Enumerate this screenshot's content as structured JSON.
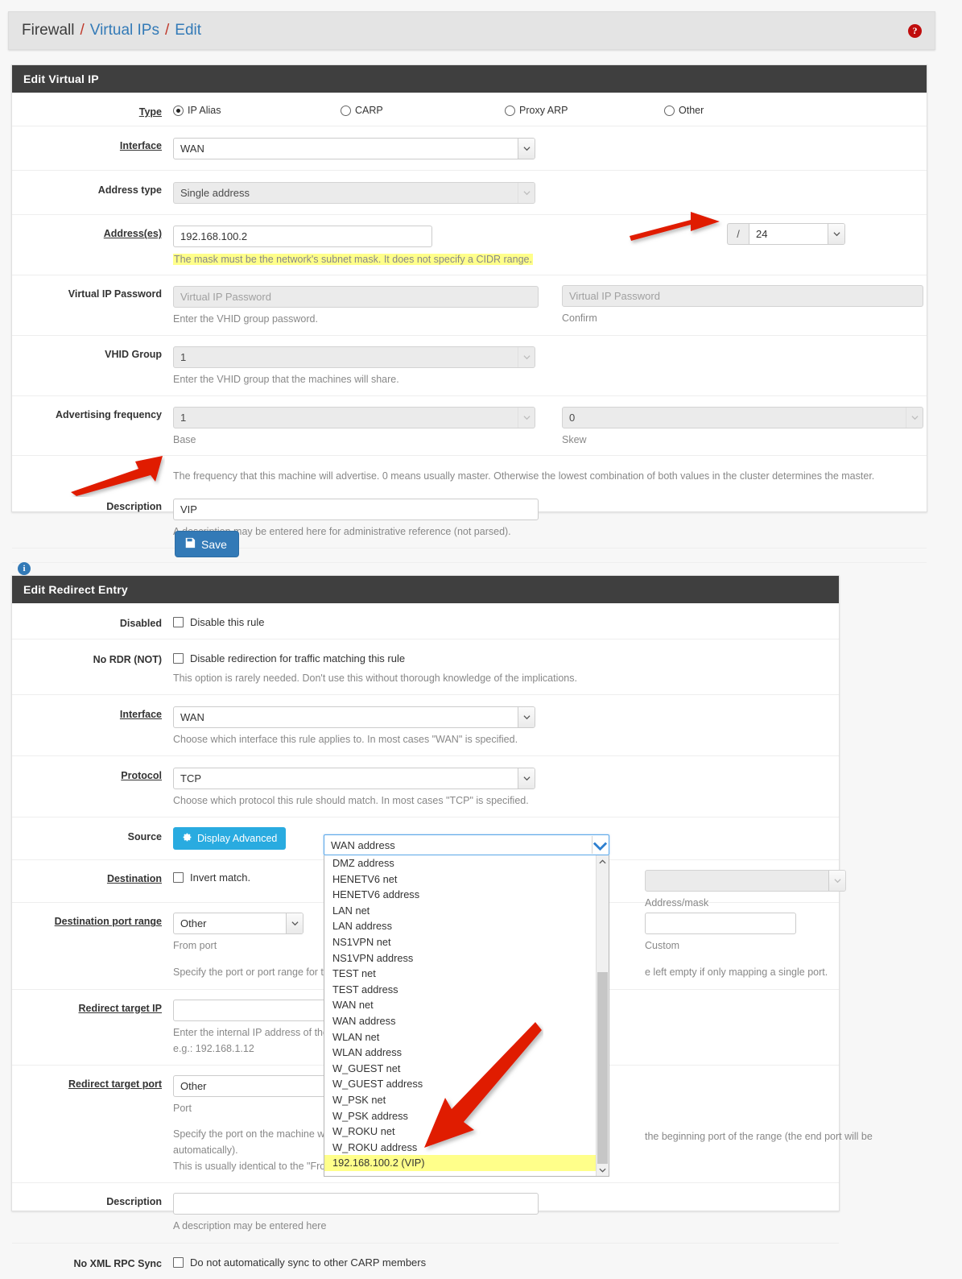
{
  "breadcrumb": {
    "items": [
      {
        "label": "Firewall",
        "link": false
      },
      {
        "label": "Virtual IPs",
        "link": true
      },
      {
        "label": "Edit",
        "link": true
      }
    ],
    "separator": "/",
    "help_icon": "question-mark-icon",
    "help_glyph": "?"
  },
  "vip_panel": {
    "title": "Edit Virtual IP",
    "type": {
      "label": "Type",
      "options": [
        {
          "label": "IP Alias",
          "selected": true
        },
        {
          "label": "CARP",
          "selected": false
        },
        {
          "label": "Proxy ARP",
          "selected": false
        },
        {
          "label": "Other",
          "selected": false
        }
      ]
    },
    "interface": {
      "label": "Interface",
      "value": "WAN"
    },
    "address_type": {
      "label": "Address type",
      "value": "Single address"
    },
    "addresses": {
      "label": "Address(es)",
      "value": "192.168.100.2",
      "prefix_symbol": "/",
      "mask_value": "24",
      "highlight_note": "The mask must be the network's subnet mask. It does not specify a CIDR range."
    },
    "vip_password": {
      "label": "Virtual IP Password",
      "placeholder": "Virtual IP Password",
      "value": "",
      "help": "Enter the VHID group password.",
      "confirm_placeholder": "Virtual IP Password",
      "confirm_value": "",
      "confirm_help": "Confirm"
    },
    "vhid_group": {
      "label": "VHID Group",
      "value": "1",
      "help": "Enter the VHID group that the machines will share."
    },
    "advertising_frequency": {
      "label": "Advertising frequency",
      "base_value": "1",
      "base_help": "Base",
      "skew_value": "0",
      "skew_help": "Skew",
      "help": "The frequency that this machine will advertise. 0 means usually master. Otherwise the lowest combination of both values in the cluster determines the master."
    },
    "description": {
      "label": "Description",
      "value": "VIP",
      "help": "A description may be entered here for administrative reference (not parsed)."
    },
    "save_button": {
      "label": "Save",
      "icon": "floppy-disk-icon"
    }
  },
  "info_icon": {
    "name": "info-icon",
    "glyph": "i"
  },
  "redirect_panel": {
    "title": "Edit Redirect Entry",
    "disabled": {
      "label": "Disabled",
      "checkbox_label": "Disable this rule",
      "checked": false
    },
    "no_rdr": {
      "label": "No RDR (NOT)",
      "checkbox_label": "Disable redirection for traffic matching this rule",
      "checked": false,
      "help": "This option is rarely needed. Don't use this without thorough knowledge of the implications."
    },
    "interface": {
      "label": "Interface",
      "value": "WAN",
      "help": "Choose which interface this rule applies to. In most cases \"WAN\" is specified."
    },
    "protocol": {
      "label": "Protocol",
      "value": "TCP",
      "help": "Choose which protocol this rule should match. In most cases \"TCP\" is specified."
    },
    "source": {
      "label": "Source",
      "advanced_button": "Display Advanced",
      "advanced_icon": "gear-icon"
    },
    "destination": {
      "label": "Destination",
      "invert_label": "Invert match.",
      "invert_checked": false,
      "selected_value": "WAN address",
      "address_mask_value": "",
      "address_mask_help": "Address/mask",
      "options": [
        "DMZ address",
        "HENETV6 net",
        "HENETV6 address",
        "LAN net",
        "LAN address",
        "NS1VPN net",
        "NS1VPN address",
        "TEST net",
        "TEST address",
        "WAN net",
        "WAN address",
        "WLAN net",
        "WLAN address",
        "W_GUEST net",
        "W_GUEST address",
        "W_PSK net",
        "W_PSK address",
        "W_ROKU net",
        "W_ROKU address",
        "192.168.100.2 (VIP)"
      ],
      "highlighted_option": "192.168.100.2 (VIP)"
    },
    "dest_port_range": {
      "label": "Destination port range",
      "from_value": "Other",
      "from_help": "From port",
      "custom_value": "",
      "custom_help": "Custom",
      "help_left": "Specify the port or port range for th",
      "help_right": "e left empty if only mapping a single port."
    },
    "redirect_target_ip": {
      "label": "Redirect target IP",
      "value": "",
      "help_line1": "Enter the internal IP address of the",
      "help_line2": "e.g.: 192.168.1.12"
    },
    "redirect_target_port": {
      "label": "Redirect target port",
      "value": "Other",
      "port_help": "Port",
      "help_line1": "Specify the port on the machine wi",
      "help_line2": "automatically).",
      "help_line3": "This is usually identical to the \"Fro",
      "help_right": "the beginning port of the range (the end port will be"
    },
    "description": {
      "label": "Description",
      "value": "",
      "help": "A description may be entered here"
    },
    "no_xmlrpc": {
      "label": "No XML RPC Sync",
      "checkbox_label": "Do not automatically sync to other CARP members",
      "checked": false
    }
  },
  "annotations": {
    "arrow_color": "#e01b00",
    "arrows": [
      "arrow-to-mask-field",
      "arrow-to-description-field",
      "arrow-to-vip-option"
    ]
  }
}
